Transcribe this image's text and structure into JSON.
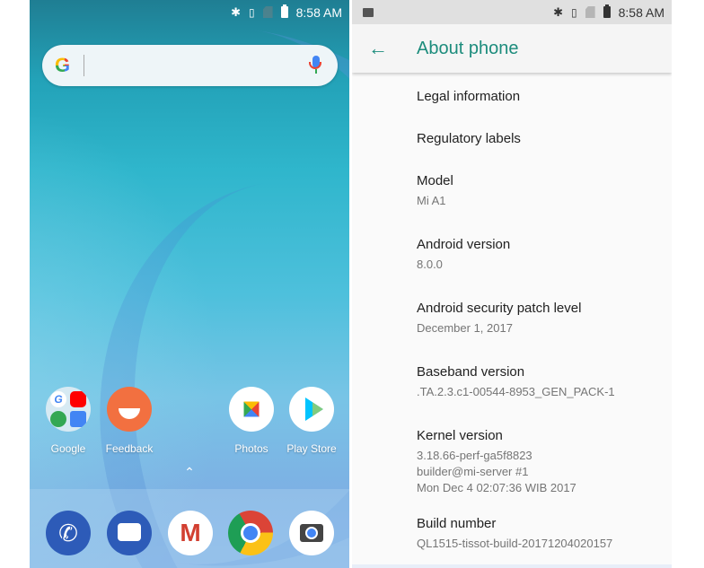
{
  "home": {
    "status_bar": {
      "time": "8:58 AM",
      "icons": [
        "bluetooth-icon",
        "vibrate-icon",
        "no-sim-icon",
        "battery-icon"
      ]
    },
    "search": {
      "logo": "G",
      "placeholder": ""
    },
    "apps": [
      {
        "label": "Google",
        "icon": "google-folder-icon"
      },
      {
        "label": "Feedback",
        "icon": "feedback-icon"
      },
      {
        "label": "Photos",
        "icon": "photos-icon"
      },
      {
        "label": "Play Store",
        "icon": "play-store-icon"
      }
    ],
    "app_drawer_chevron": "⌃",
    "dock": [
      {
        "name": "Phone",
        "icon": "phone-icon",
        "glyph": "✆"
      },
      {
        "name": "Messages",
        "icon": "messages-icon",
        "glyph": ""
      },
      {
        "name": "Gmail",
        "icon": "gmail-icon",
        "glyph": "M"
      },
      {
        "name": "Chrome",
        "icon": "chrome-icon",
        "glyph": ""
      },
      {
        "name": "Camera",
        "icon": "camera-icon",
        "glyph": ""
      }
    ]
  },
  "about": {
    "status_bar": {
      "time": "8:58 AM",
      "left_icon": "gallery-notification-icon",
      "icons": [
        "bluetooth-icon",
        "vibrate-icon",
        "no-sim-icon",
        "battery-icon"
      ]
    },
    "app_bar": {
      "back": "←",
      "title": "About phone"
    },
    "accent_color": "#1c8c7c",
    "items": [
      {
        "title": "Legal information",
        "summary": ""
      },
      {
        "title": "Regulatory labels",
        "summary": ""
      },
      {
        "title": "Model",
        "summary": "Mi A1"
      },
      {
        "title": "Android version",
        "summary": "8.0.0"
      },
      {
        "title": "Android security patch level",
        "summary": "December 1, 2017"
      },
      {
        "title": "Baseband version",
        "summary": ".TA.2.3.c1-00544-8953_GEN_PACK-1"
      },
      {
        "title": "Kernel version",
        "summary": "3.18.66-perf-ga5f8823\nbuilder@mi-server #1\nMon Dec 4 02:07:36 WIB 2017"
      },
      {
        "title": "Build number",
        "summary": "QL1515-tissot-build-20171204020157"
      }
    ]
  },
  "glyphs": {
    "bluetooth": "✱",
    "vibrate": "▯"
  }
}
